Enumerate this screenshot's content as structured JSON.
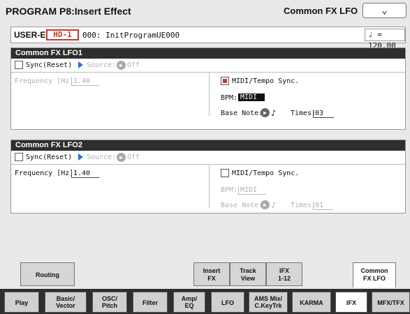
{
  "header": {
    "title": "PROGRAM P8:Insert Effect",
    "page_selector": "Common FX LFO",
    "dropdown_icon": "chevron-down-icon"
  },
  "program": {
    "bank": "USER-E",
    "source": "HD-1",
    "number_name": "000: InitProgramUE000",
    "tempo_symbol": "♩ =",
    "tempo_value": "120.00"
  },
  "lfo1": {
    "title": "Common FX LFO1",
    "sync_label": "Sync(Reset)",
    "source_label": "Source:",
    "source_value": "Off",
    "freq_label": "Frequency [Hz]:",
    "freq_value": "1.40",
    "midi_sync_label": "MIDI/Tempo Sync.",
    "bpm_label": "BPM:",
    "bpm_value": "MIDI",
    "base_note_label": "Base Note:",
    "base_note_value": "♪",
    "times_label": "Times:",
    "times_value": "03"
  },
  "lfo2": {
    "title": "Common FX LFO2",
    "sync_label": "Sync(Reset)",
    "source_label": "Source:",
    "source_value": "Off",
    "freq_label": "Frequency [Hz]:",
    "freq_value": "1.40",
    "midi_sync_label": "MIDI/Tempo Sync.",
    "bpm_label": "BPM:",
    "bpm_value": "MIDI",
    "base_note_label": "Base Note:",
    "base_note_value": "♪",
    "times_label": "Times:",
    "times_value": "01"
  },
  "sub_tabs": [
    {
      "line1": "Routing",
      "line2": ""
    },
    {
      "line1": "Insert",
      "line2": "FX"
    },
    {
      "line1": "Track",
      "line2": "View"
    },
    {
      "line1": "IFX",
      "line2": "1-12"
    },
    {
      "line1": "Common",
      "line2": "FX LFO"
    }
  ],
  "main_tabs": [
    {
      "line1": "Play",
      "line2": ""
    },
    {
      "line1": "Basic/",
      "line2": "Vector"
    },
    {
      "line1": "OSC/",
      "line2": "Pitch"
    },
    {
      "line1": "Filter",
      "line2": ""
    },
    {
      "line1": "Amp/",
      "line2": "EQ"
    },
    {
      "line1": "LFO",
      "line2": ""
    },
    {
      "line1": "AMS Mix/",
      "line2": "C.KeyTrk"
    },
    {
      "line1": "KARMA",
      "line2": ""
    },
    {
      "line1": "IFX",
      "line2": ""
    },
    {
      "line1": "MFX/TFX",
      "line2": ""
    }
  ]
}
